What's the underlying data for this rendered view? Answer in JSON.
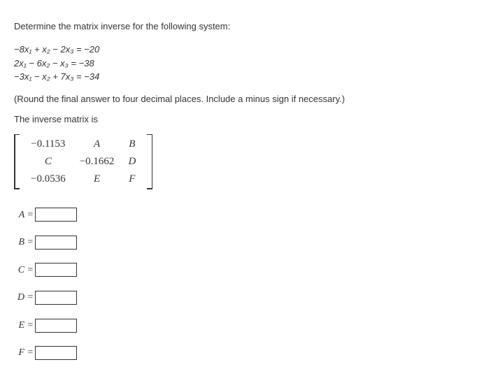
{
  "instruction": "Determine the matrix inverse for the following system:",
  "equations": [
    "−8x₁ + x₂ − 2x₃ = −20",
    "2x₁ − 6x₂ − x₃ = −38",
    "−3x₁ − x₂ + 7x₃ = −34"
  ],
  "note": "(Round the final answer to four decimal places. Include a minus sign if necessary.)",
  "statement": "The inverse matrix is",
  "matrix": {
    "r1c1": "−0.1153",
    "r1c2": "A",
    "r1c3": "B",
    "r2c1": "C",
    "r2c2": "−0.1662",
    "r2c3": "D",
    "r3c1": "−0.0536",
    "r3c2": "E",
    "r3c3": "F"
  },
  "answer_labels": {
    "A": "A =",
    "B": "B =",
    "C": "C =",
    "D": "D =",
    "E": "E =",
    "F": "F ="
  }
}
